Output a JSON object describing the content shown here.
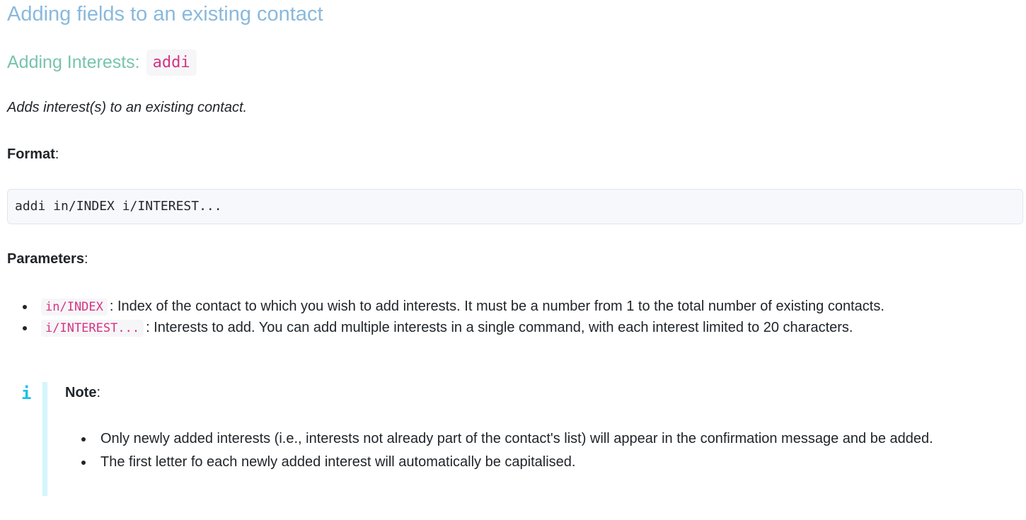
{
  "section_title": "Adding fields to an existing contact",
  "command": {
    "title": "Adding Interests:",
    "code": "addi",
    "description": "Adds interest(s) to an existing contact."
  },
  "format": {
    "label": "Format",
    "code": "addi in/INDEX i/INTEREST..."
  },
  "parameters": {
    "label": "Parameters",
    "items": [
      {
        "code": "in/INDEX",
        "text": ": Index of the contact to which you wish to add interests. It must be a number from 1 to the total number of existing contacts."
      },
      {
        "code": "i/INTEREST...",
        "text": ": Interests to add. You can add multiple interests in a single command, with each interest limited to 20 characters."
      }
    ]
  },
  "note": {
    "icon": "info-icon",
    "icon_glyph": "i",
    "label": "Note",
    "items": [
      "Only newly added interests (i.e., interests not already part of the contact's list) will appear in the confirmation message and be added.",
      "The first letter fo each newly added interest will automatically be capitalised."
    ]
  },
  "colors": {
    "section_title": "#89b9dd",
    "command_title": "#77c4ae",
    "inline_code": "#d63384",
    "note_accent": "#17c1e8"
  }
}
